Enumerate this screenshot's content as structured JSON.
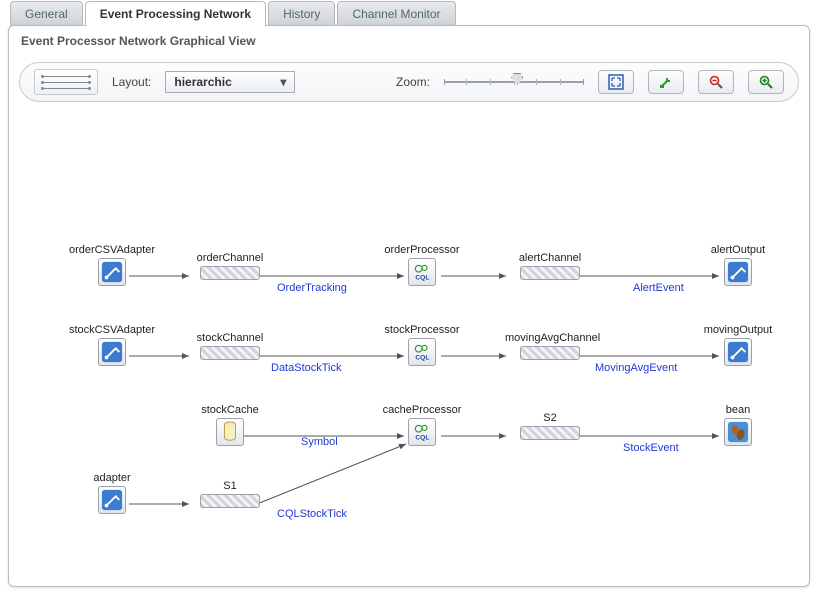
{
  "tabs": [
    "General",
    "Event Processing Network",
    "History",
    "Channel Monitor"
  ],
  "active_tab_index": 1,
  "panel_title": "Event Processor Network Graphical View",
  "toolbar": {
    "layout_label": "Layout:",
    "layout_value": "hierarchic",
    "zoom_label": "Zoom:",
    "buttons": {
      "fit": "fit-to-screen",
      "actual": "actual-size",
      "zoom_out": "zoom-out",
      "zoom_in": "zoom-in"
    }
  },
  "nodes": {
    "orderCSVAdapter": {
      "label": "orderCSVAdapter",
      "type": "adapter"
    },
    "orderChannel": {
      "label": "orderChannel",
      "type": "channel"
    },
    "orderProcessor": {
      "label": "orderProcessor",
      "type": "processor"
    },
    "alertChannel": {
      "label": "alertChannel",
      "type": "channel"
    },
    "alertOutput": {
      "label": "alertOutput",
      "type": "adapter"
    },
    "stockCSVAdapter": {
      "label": "stockCSVAdapter",
      "type": "adapter"
    },
    "stockChannel": {
      "label": "stockChannel",
      "type": "channel"
    },
    "stockProcessor": {
      "label": "stockProcessor",
      "type": "processor"
    },
    "movingAvgChannel": {
      "label": "movingAvgChannel",
      "type": "channel"
    },
    "movingOutput": {
      "label": "movingOutput",
      "type": "adapter"
    },
    "stockCache": {
      "label": "stockCache",
      "type": "cache"
    },
    "cacheProcessor": {
      "label": "cacheProcessor",
      "type": "processor"
    },
    "S2": {
      "label": "S2",
      "type": "channel"
    },
    "bean": {
      "label": "bean",
      "type": "bean"
    },
    "adapter": {
      "label": "adapter",
      "type": "adapter"
    },
    "S1": {
      "label": "S1",
      "type": "channel"
    }
  },
  "edge_labels": {
    "e1": "OrderTracking",
    "e2": "AlertEvent",
    "e3": "DataStockTick",
    "e4": "MovingAvgEvent",
    "e5": "Symbol",
    "e6": "StockEvent",
    "e7": "CQLStockTick"
  }
}
